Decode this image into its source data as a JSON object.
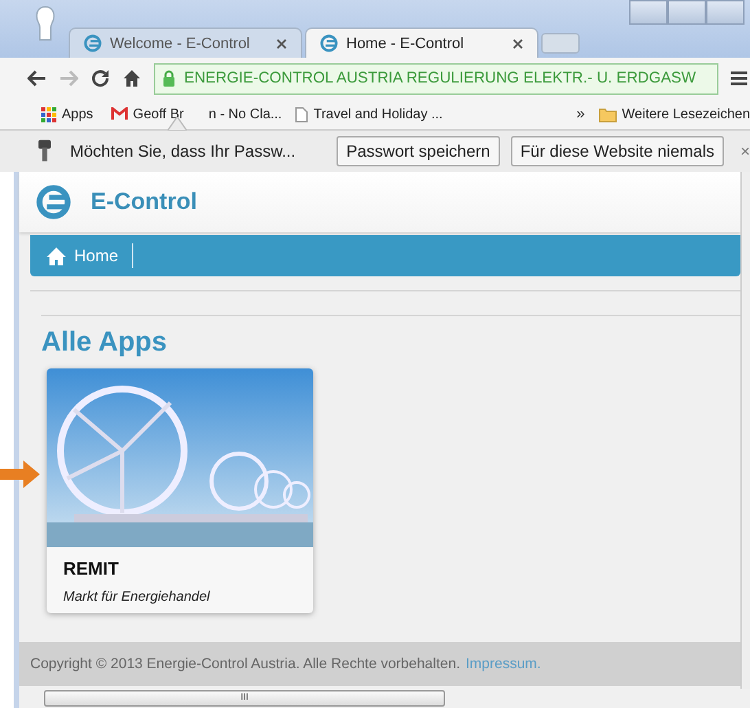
{
  "tabs": [
    {
      "title": "Welcome - E-Control",
      "selected": false
    },
    {
      "title": "Home - E-Control",
      "selected": true
    }
  ],
  "address": {
    "value": "ENERGIE-CONTROL AUSTRIA REGULIERUNG ELEKTR.- U. ERDGASW"
  },
  "bookmarks": [
    {
      "kind": "apps",
      "label": "Apps"
    },
    {
      "kind": "mail",
      "label_start": "Geoff Br",
      "label_end": "n - No Cla..."
    },
    {
      "kind": "page",
      "label": "Travel and Holiday ..."
    }
  ],
  "bookmarks_more": "»",
  "bookmarks_other": "Weitere Lesezeichen",
  "password_bar": {
    "message": "Möchten Sie, dass Ihr Passw...",
    "buttons": [
      "Passwort speichern",
      "Für diese Website niemals"
    ],
    "close": "×"
  },
  "site": {
    "brand": "E-Control",
    "nav": [
      {
        "label": "Home"
      }
    ],
    "heading": "Alle Apps",
    "apps": [
      {
        "title": "REMIT",
        "subtitle": "Markt für Energiehandel"
      }
    ],
    "footer": {
      "text": "Copyright © 2013 Energie-Control Austria. Alle Rechte vorbehalten.",
      "link": "Impressum."
    }
  },
  "scrollbar_grip": "III"
}
